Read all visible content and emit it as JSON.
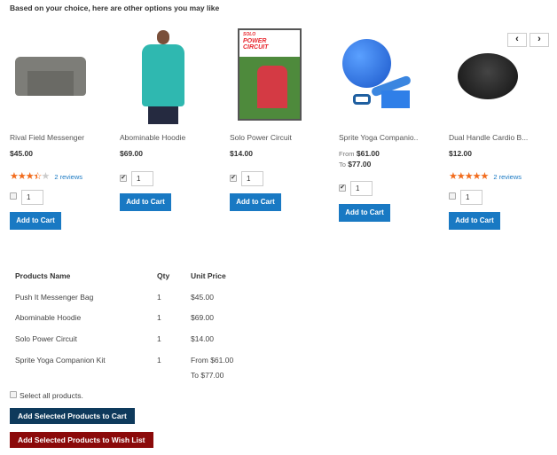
{
  "heading": "Based on your choice, here are other options you may like",
  "nav": {
    "prev": "‹",
    "next": "›"
  },
  "products": [
    {
      "name": "Rival Field Messenger",
      "price": "$45.00",
      "rating": 3.5,
      "reviews": "2 reviews",
      "checked": false,
      "qty": "1",
      "add": "Add to Cart"
    },
    {
      "name": "Abominable Hoodie",
      "price": "$69.00",
      "checked": true,
      "qty": "1",
      "add": "Add to Cart"
    },
    {
      "name": "Solo Power Circuit",
      "price": "$14.00",
      "checked": true,
      "qty": "1",
      "add": "Add to Cart",
      "cover": {
        "l1": "SOLO",
        "l2": "POWER",
        "l3": "CIRCUIT"
      }
    },
    {
      "name": "Sprite Yoga Companio..",
      "from_label": "From",
      "from": "$61.00",
      "to_label": "To",
      "to": "$77.00",
      "checked": true,
      "qty": "1",
      "add": "Add to Cart"
    },
    {
      "name": "Dual Handle Cardio B...",
      "price": "$12.00",
      "rating": 5,
      "reviews": "2 reviews",
      "checked": false,
      "qty": "1",
      "add": "Add to Cart"
    }
  ],
  "table": {
    "headers": [
      "Products Name",
      "Qty",
      "Unit Price"
    ],
    "rows": [
      {
        "name": "Push It Messenger Bag",
        "qty": "1",
        "price": "$45.00"
      },
      {
        "name": "Abominable Hoodie",
        "qty": "1",
        "price": "$69.00"
      },
      {
        "name": "Solo Power Circuit",
        "qty": "1",
        "price": "$14.00"
      },
      {
        "name": "Sprite Yoga Companion Kit",
        "qty": "1",
        "price": "From $61.00",
        "price2": "To $77.00"
      }
    ]
  },
  "select_all": "Select all products.",
  "add_selected_cart": "Add Selected Products to Cart",
  "add_selected_wishlist": "Add Selected Products to Wish List",
  "colors": {
    "primary": "#1979c3",
    "dark_button": "#0e3a5c",
    "wishlist_button": "#8b0a0a",
    "star": "#f26c1d"
  }
}
